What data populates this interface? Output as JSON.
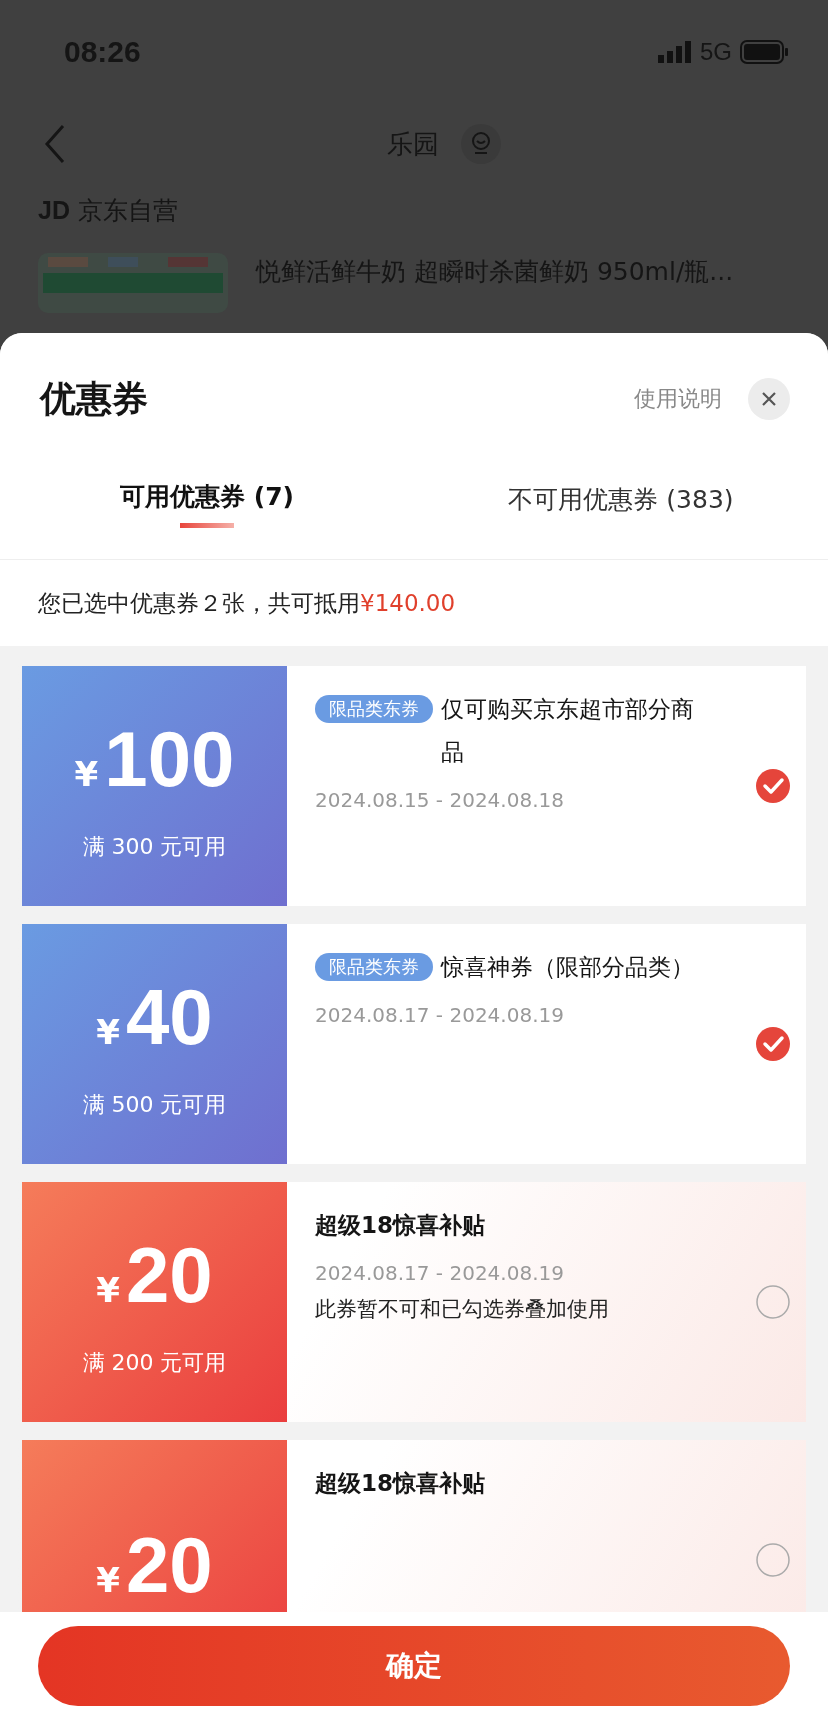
{
  "status_bar": {
    "time": "08:26",
    "network": "5G"
  },
  "page": {
    "title": "乐园",
    "shop": "京东自营",
    "shop_badge": "JD",
    "product_title": "悦鲜活鲜牛奶 超瞬时杀菌鲜奶 950ml/瓶..."
  },
  "sheet": {
    "title": "优惠券",
    "help_link": "使用说明",
    "tabs": [
      {
        "label": "可用优惠券 (7)",
        "selected": true
      },
      {
        "label": "不可用优惠券 (383)",
        "selected": false
      }
    ],
    "summary": {
      "text": "您已选中优惠券２张，共可抵用",
      "amount": "¥140.00"
    },
    "coupons": [
      {
        "kind": "limited",
        "currency": "¥",
        "amount": "100",
        "condition": "满 300 元可用",
        "tag": "限品类东券",
        "title": "仅可购买京东超市部分商品",
        "dates": "2024.08.15 - 2024.08.18",
        "selected": true
      },
      {
        "kind": "limited",
        "currency": "¥",
        "amount": "40",
        "condition": "满 500 元可用",
        "tag": "限品类东券",
        "title": "惊喜神券（限部分品类）",
        "dates": "2024.08.17 - 2024.08.19",
        "selected": true
      },
      {
        "kind": "bonus",
        "currency": "¥",
        "amount": "20",
        "condition": "满 200 元可用",
        "title": "超级18惊喜补贴",
        "dates": "2024.08.17 - 2024.08.19",
        "note": "此券暂不可和已勾选券叠加使用",
        "selected": false
      },
      {
        "kind": "bonus",
        "currency": "¥",
        "amount": "20",
        "title": "超级18惊喜补贴",
        "selected": false
      }
    ],
    "confirm_button": "确定"
  }
}
